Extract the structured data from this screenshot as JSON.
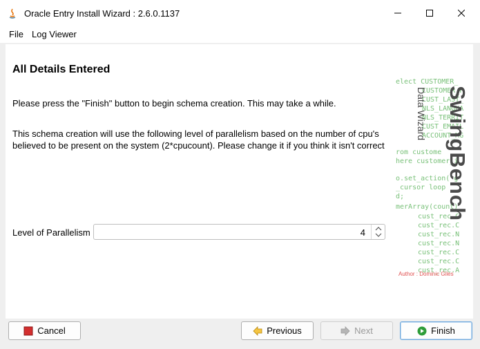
{
  "window": {
    "title": "Oracle Entry Install Wizard : 2.6.0.1137"
  },
  "menu": {
    "items": [
      "File",
      "Log Viewer"
    ]
  },
  "page": {
    "heading": "All Details Entered",
    "para1": "Please press the \"Finish\" button to begin schema creation. This may take a while.",
    "para2": "This schema creation will use the following level of parallelism based on the number of cpu's believed to be present on the system (2*cpucount). Please change it if you think it isn't correct",
    "parallelism_label": "Level of Parallelism",
    "parallelism_value": "4"
  },
  "brand": {
    "title": "SwingBench",
    "subtitle": "Data Wizard",
    "author": "Author : Dominic Giles",
    "code_lines": [
      "elect CUSTOMER_",
      "CUSTOMER_F",
      "CUST_LAST_",
      "NLS_LANGUA",
      "NLS_TERRIT",
      "CUST_EMAIL",
      "ACCOUNT_MG",
      "rom custome",
      "here customer_i",
      "o.set_action('g",
      "_cursor loop",
      "d;",
      "merArray(count)",
      "cust_rec.C",
      "cust_rec.C",
      "cust_rec.N",
      "cust_rec.N",
      "cust_rec.C",
      "cust_rec.C",
      "cust_rec.A"
    ]
  },
  "buttons": {
    "cancel": "Cancel",
    "previous": "Previous",
    "next": "Next",
    "finish": "Finish"
  },
  "colors": {
    "code_green": "#78c078",
    "author_red": "#e05050",
    "cancel_icon": "#d32f2f",
    "previous_icon": "#f5c542",
    "finish_icon": "#2e9d3a"
  }
}
